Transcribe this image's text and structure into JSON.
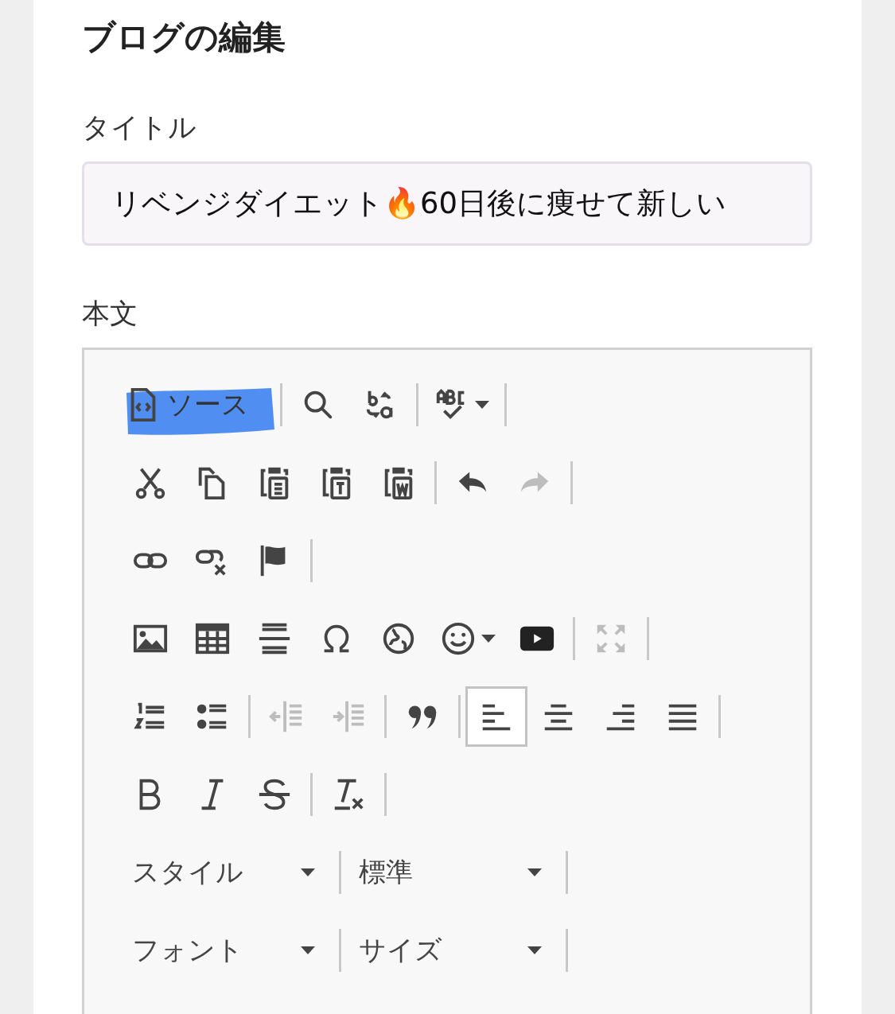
{
  "heading": "ブログの編集",
  "title_field": {
    "label": "タイトル",
    "value": "リベンジダイエット🔥60日後に痩せて新しい"
  },
  "body_field": {
    "label": "本文"
  },
  "toolbar": {
    "rows": [
      [
        [
          {
            "kind": "source",
            "label": "ソース",
            "highlighted": true,
            "disabled": false,
            "menu": false
          }
        ],
        [
          {
            "kind": "find",
            "disabled": false,
            "menu": false
          },
          {
            "kind": "replace",
            "disabled": false,
            "menu": false
          }
        ],
        [
          {
            "kind": "spellcheck",
            "disabled": false,
            "menu": true
          }
        ]
      ],
      [
        [
          {
            "kind": "cut",
            "disabled": false,
            "menu": false
          },
          {
            "kind": "copy",
            "disabled": false,
            "menu": false
          },
          {
            "kind": "paste",
            "disabled": false,
            "menu": false
          },
          {
            "kind": "pastetext",
            "disabled": false,
            "menu": false
          },
          {
            "kind": "pasteword",
            "disabled": false,
            "menu": false
          }
        ],
        [
          {
            "kind": "undo",
            "disabled": false,
            "menu": false
          },
          {
            "kind": "redo",
            "disabled": true,
            "menu": false
          }
        ]
      ],
      [
        [
          {
            "kind": "link",
            "disabled": false,
            "menu": false
          },
          {
            "kind": "unlink",
            "disabled": false,
            "menu": false
          },
          {
            "kind": "anchor",
            "disabled": false,
            "menu": false
          }
        ]
      ],
      [
        [
          {
            "kind": "image",
            "disabled": false,
            "menu": false
          },
          {
            "kind": "table",
            "disabled": false,
            "menu": false
          },
          {
            "kind": "hrule",
            "disabled": false,
            "menu": false
          },
          {
            "kind": "omega",
            "disabled": false,
            "menu": false
          },
          {
            "kind": "globe",
            "disabled": false,
            "menu": false
          },
          {
            "kind": "smiley",
            "disabled": false,
            "menu": true
          },
          {
            "kind": "video",
            "disabled": false,
            "menu": false
          }
        ],
        [
          {
            "kind": "maximize",
            "disabled": true,
            "menu": false
          }
        ]
      ],
      [
        [
          {
            "kind": "numlist",
            "disabled": false,
            "menu": false
          },
          {
            "kind": "bullist",
            "disabled": false,
            "menu": false
          }
        ],
        [
          {
            "kind": "outdent",
            "disabled": true,
            "menu": false
          },
          {
            "kind": "indent",
            "disabled": true,
            "menu": false
          }
        ],
        [
          {
            "kind": "quote",
            "disabled": false,
            "menu": false
          }
        ],
        [
          {
            "kind": "alignleft",
            "disabled": false,
            "menu": false,
            "selected": true
          },
          {
            "kind": "aligncenter",
            "disabled": false,
            "menu": false,
            "selected": false
          },
          {
            "kind": "alignright",
            "disabled": false,
            "menu": false,
            "selected": false
          },
          {
            "kind": "justify",
            "disabled": false,
            "menu": false,
            "selected": false
          }
        ]
      ],
      [
        [
          {
            "kind": "bold",
            "disabled": false,
            "menu": false
          },
          {
            "kind": "italic",
            "disabled": false,
            "menu": false
          },
          {
            "kind": "strike",
            "disabled": false,
            "menu": false
          }
        ],
        [
          {
            "kind": "clearformat",
            "disabled": false,
            "menu": false
          }
        ]
      ],
      [
        [
          {
            "kind": "combo",
            "label": "スタイル",
            "disabled": false,
            "menu": true
          }
        ],
        [
          {
            "kind": "combo",
            "label": "標準",
            "disabled": false,
            "menu": true
          }
        ]
      ],
      [
        [
          {
            "kind": "combo",
            "label": "フォント",
            "disabled": false,
            "menu": true
          }
        ],
        [
          {
            "kind": "combo",
            "label": "サイズ",
            "disabled": false,
            "menu": true
          }
        ]
      ]
    ]
  }
}
